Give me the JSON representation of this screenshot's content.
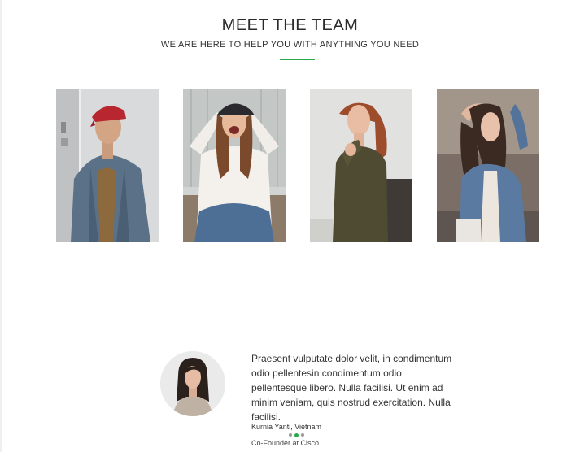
{
  "section": {
    "title": "MEET THE TEAM",
    "subtitle": "WE ARE HERE TO HELP YOU WITH ANYTHING YOU NEED",
    "accent_color": "#2aa84a"
  },
  "team_photos": [
    {
      "icon": "man-red-cap-denim-jacket-photo"
    },
    {
      "icon": "woman-black-cap-laughing-photo"
    },
    {
      "icon": "woman-olive-sweater-photo"
    },
    {
      "icon": "woman-denim-jacket-photo"
    }
  ],
  "testimonial": {
    "avatar_icon": "woman-portrait-avatar",
    "quote": "Praesent vulputate dolor velit, in condimentum odio pellentesin condimentum odio pellentesque libero. Nulla facilisi. Ut enim ad minim veniam, quis nostrud exercitation. Nulla facilisi.",
    "author": "Kurnia Yanti, Vietnam",
    "role": "Co-Founder at Cisco"
  },
  "carousel": {
    "dot_count": 3,
    "active_index": 1
  }
}
